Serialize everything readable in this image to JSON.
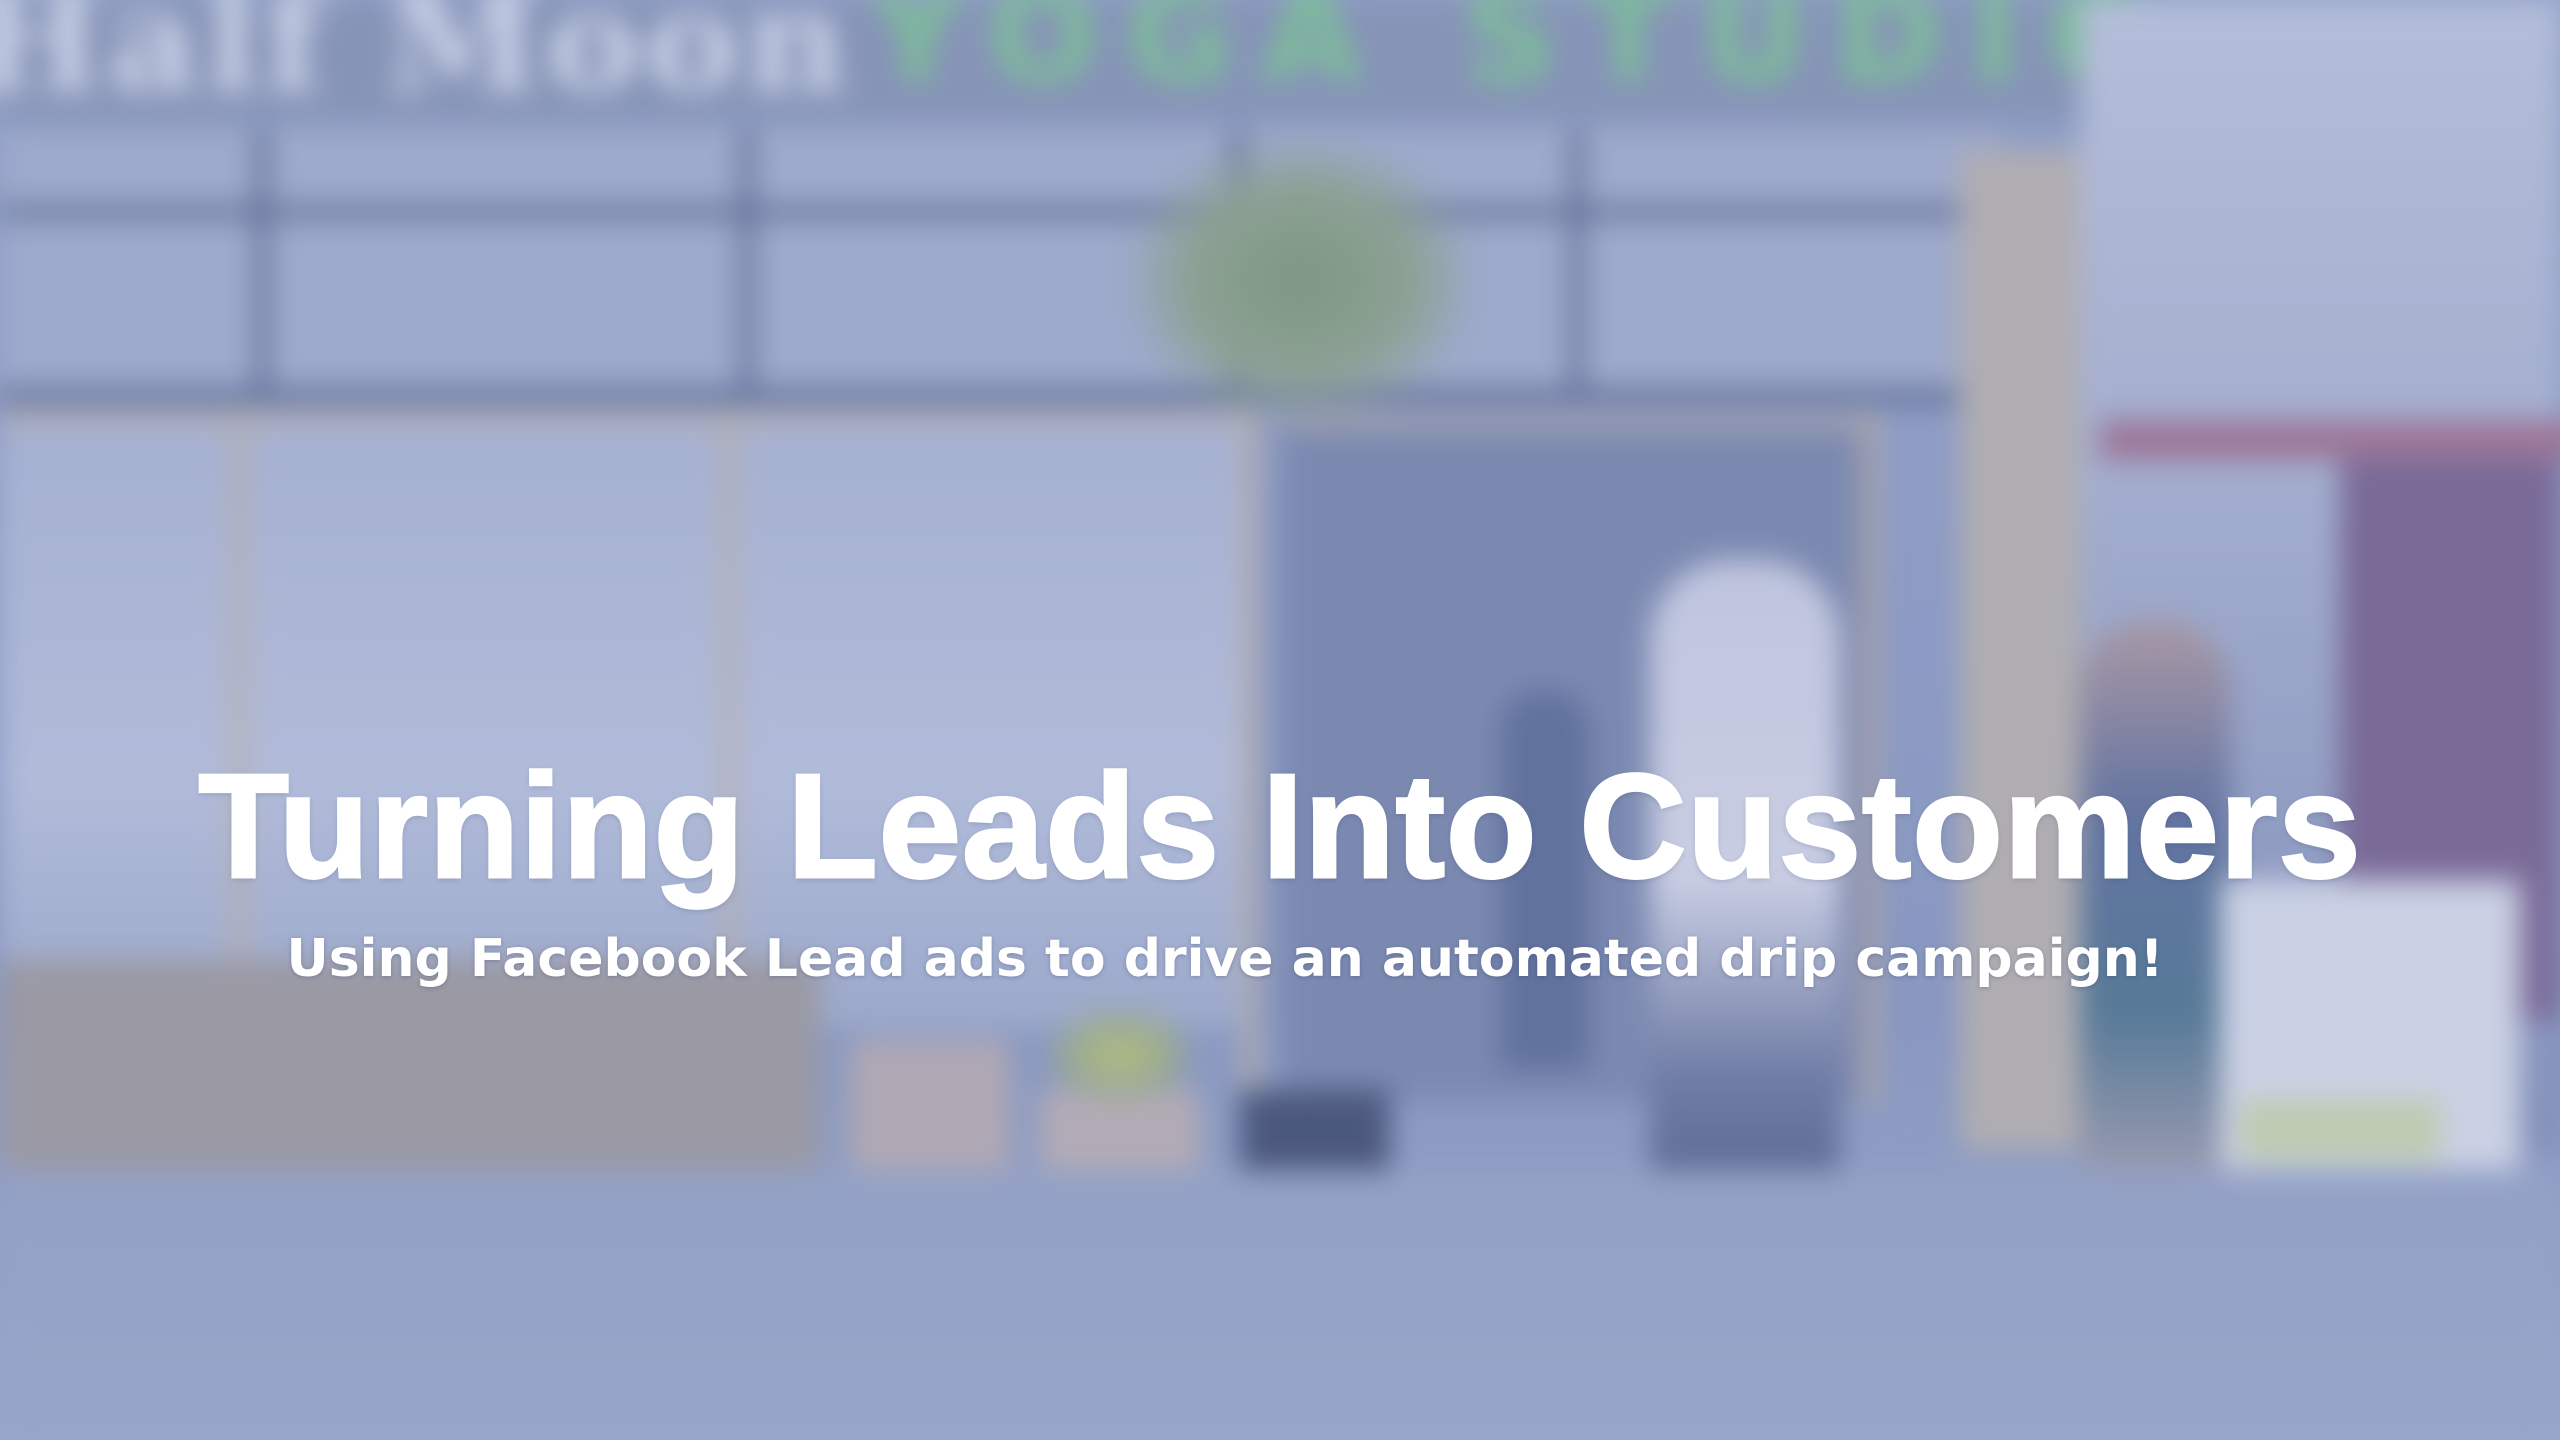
{
  "background": {
    "sign_text_left": "Half Moon",
    "sign_text_right": "YOGA STUDIO"
  },
  "slide": {
    "title": "Turning Leads Into Customers",
    "subtitle": "Using Facebook Lead ads to drive an automated drip campaign!"
  },
  "colors": {
    "tint_overlay": "#788cc8",
    "title_text": "#ffffff",
    "sign_green": "#7fcf8a"
  }
}
